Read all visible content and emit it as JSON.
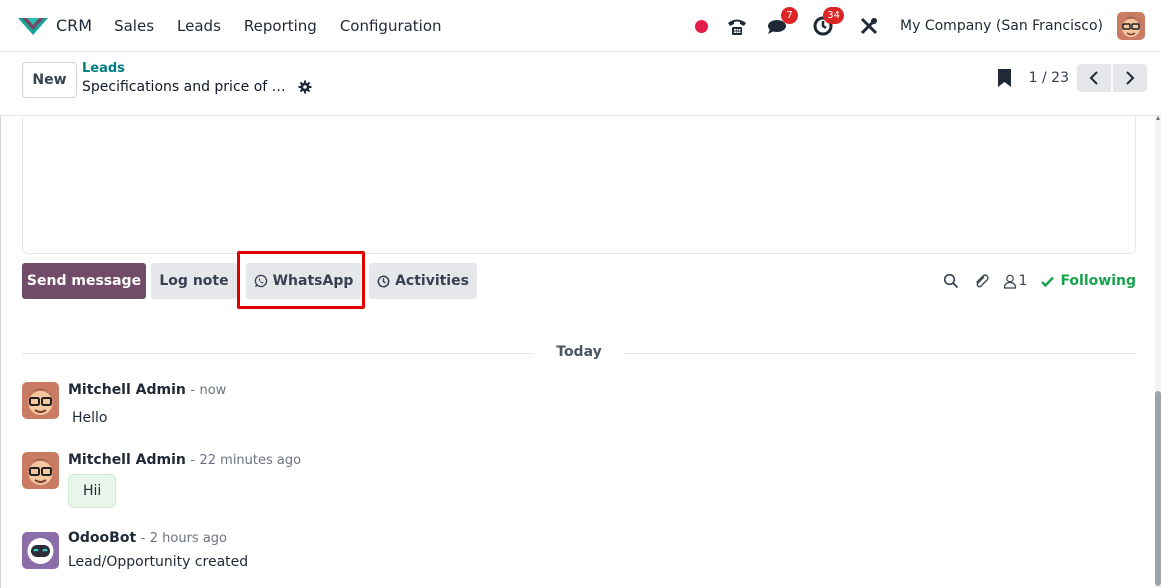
{
  "navbar": {
    "app_name": "CRM",
    "menu": [
      "Sales",
      "Leads",
      "Reporting",
      "Configuration"
    ],
    "messages_badge": "7",
    "activities_badge": "34",
    "company": "My Company (San Francisco)"
  },
  "control_panel": {
    "new_label": "New",
    "breadcrumb": "Leads",
    "record_title": "Specifications and price of …",
    "pager_value": "1 / 23"
  },
  "composer": {
    "send_message": "Send message",
    "log_note": "Log note",
    "whatsapp": "WhatsApp",
    "activities": "Activities",
    "followers_count": "1",
    "following": "Following"
  },
  "thread": {
    "date_label": "Today",
    "messages": [
      {
        "author": "Mitchell Admin",
        "separator": "-",
        "time": "now",
        "body": "Hello"
      },
      {
        "author": "Mitchell Admin",
        "separator": "-",
        "time": "22 minutes ago",
        "body": "Hii"
      },
      {
        "author": "OdooBot",
        "separator": "-",
        "time": "2 hours ago",
        "body": "Lead/Opportunity created"
      }
    ]
  },
  "colors": {
    "primary": "#714b67",
    "link": "#017e84",
    "following": "#16a34a",
    "badge": "#dc2626",
    "highlight": "#e00000",
    "bubble": "#e8f5ea"
  },
  "icons": [
    "crm-logo-icon",
    "recording-dot-icon",
    "phone-icon",
    "chat-icon",
    "clock-icon",
    "tools-icon",
    "gear-icon",
    "bookmark-icon",
    "chevron-left-icon",
    "chevron-right-icon",
    "whatsapp-icon",
    "clock-icon",
    "search-icon",
    "paperclip-icon",
    "user-icon",
    "check-icon"
  ]
}
